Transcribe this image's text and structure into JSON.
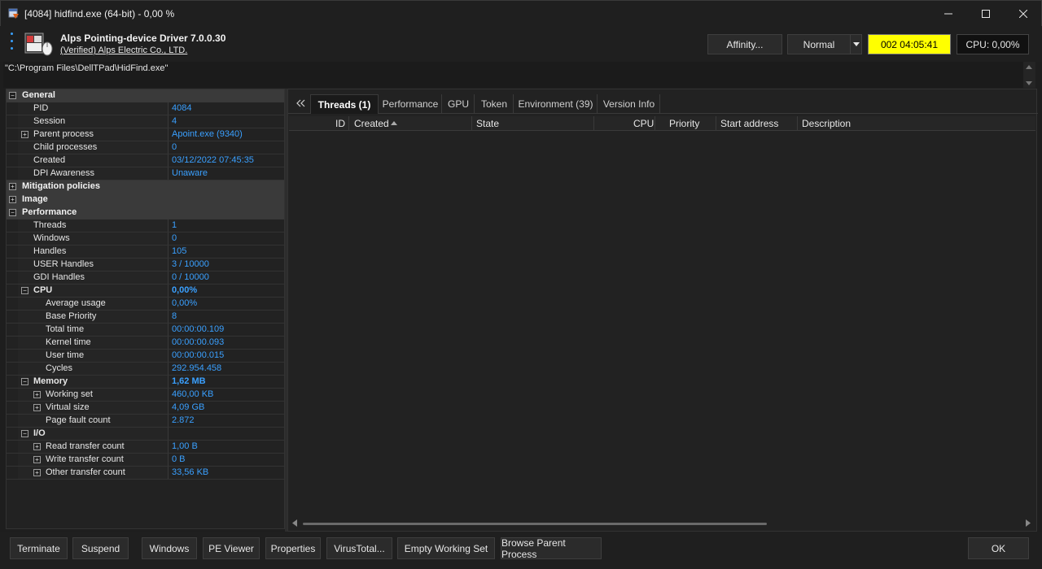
{
  "window": {
    "title": "[4084] hidfind.exe (64-bit) - 0,00 %"
  },
  "header": {
    "process_name": "Alps Pointing-device Driver 7.0.0.30",
    "vendor": "(Verified) Alps Electric Co., LTD.",
    "affinity_label": "Affinity...",
    "priority_value": "Normal",
    "uptime": "002 04:05:41",
    "cpu": "CPU: 0,00%",
    "uptime_color": "#ffff00"
  },
  "command_line": "\"C:\\Program Files\\DellTPad\\HidFind.exe\"",
  "tree": {
    "general": {
      "label": "General",
      "expanded": true
    },
    "general_rows": [
      {
        "name": "PID",
        "value": "4084"
      },
      {
        "name": "Session",
        "value": "4"
      },
      {
        "name": "Parent process",
        "value": "Apoint.exe (9340)",
        "expandable": true
      },
      {
        "name": "Child processes",
        "value": "0"
      },
      {
        "name": "Created",
        "value": "03/12/2022 07:45:35"
      },
      {
        "name": "DPI Awareness",
        "value": "Unaware"
      }
    ],
    "mitigation": {
      "label": "Mitigation policies"
    },
    "image": {
      "label": "Image"
    },
    "performance": {
      "label": "Performance"
    },
    "performance_rows": [
      {
        "name": "Threads",
        "value": "1"
      },
      {
        "name": "Windows",
        "value": "0"
      },
      {
        "name": "Handles",
        "value": "105"
      },
      {
        "name": "USER Handles",
        "value": "3 / 10000"
      },
      {
        "name": "GDI Handles",
        "value": "0 / 10000"
      }
    ],
    "cpu": {
      "label": "CPU",
      "value": "0,00%"
    },
    "cpu_rows": [
      {
        "name": "Average usage",
        "value": "0,00%"
      },
      {
        "name": "Base Priority",
        "value": "8"
      },
      {
        "name": "Total time",
        "value": "00:00:00.109"
      },
      {
        "name": "Kernel time",
        "value": "00:00:00.093"
      },
      {
        "name": "User time",
        "value": "00:00:00.015"
      },
      {
        "name": "Cycles",
        "value": "292.954.458"
      }
    ],
    "memory": {
      "label": "Memory",
      "value": "1,62 MB"
    },
    "memory_rows": [
      {
        "name": "Working set",
        "value": "460,00 KB"
      },
      {
        "name": "Virtual size",
        "value": "4,09 GB"
      },
      {
        "name": "Page fault count",
        "value": "2.872"
      }
    ],
    "io": {
      "label": "I/O",
      "value": ""
    },
    "io_rows": [
      {
        "name": "Read transfer count",
        "value": "1,00 B"
      },
      {
        "name": "Write transfer count",
        "value": "0 B"
      },
      {
        "name": "Other transfer count",
        "value": "33,56 KB"
      }
    ]
  },
  "tabs": [
    "Threads (1)",
    "Performance",
    "GPU",
    "Token",
    "Environment (39)",
    "Version Info"
  ],
  "threads_table": {
    "columns": [
      "ID",
      "Created",
      "State",
      "CPU",
      "Priority",
      "Start address",
      "Description"
    ],
    "rows": []
  },
  "footer": {
    "terminate": "Terminate",
    "suspend": "Suspend",
    "windows": "Windows",
    "pe_viewer": "PE Viewer",
    "properties": "Properties",
    "virustotal": "VirusTotal...",
    "empty_ws": "Empty Working Set",
    "browse_parent": "Browse Parent Process",
    "ok": "OK"
  }
}
